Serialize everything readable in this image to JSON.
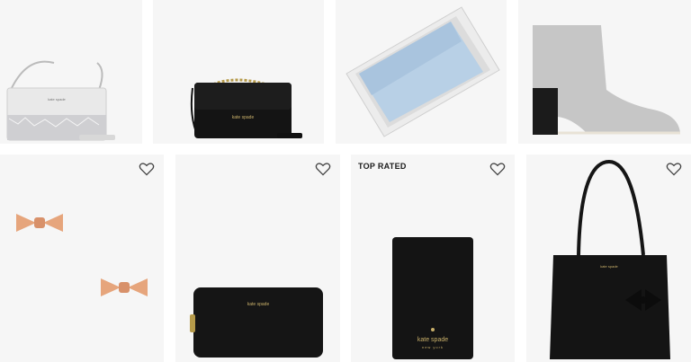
{
  "products": [
    {
      "name": "glitter crossbody bag",
      "brand": "kate spade"
    },
    {
      "name": "black crossbody with chain",
      "brand": "kate spade"
    },
    {
      "name": "glitter wallet in box"
    },
    {
      "name": "grey suede ankle boot"
    },
    {
      "name": "bow stud earrings"
    },
    {
      "name": "black zip-around wallet",
      "brand": "kate spade"
    },
    {
      "name": "black passport holder",
      "badge": "TOP RATED",
      "brand": "kate spade",
      "brand_sub": "new york"
    },
    {
      "name": "black tote with bow",
      "brand": "kate spade"
    }
  ],
  "icons": {
    "favorite": "heart-outline-icon"
  }
}
